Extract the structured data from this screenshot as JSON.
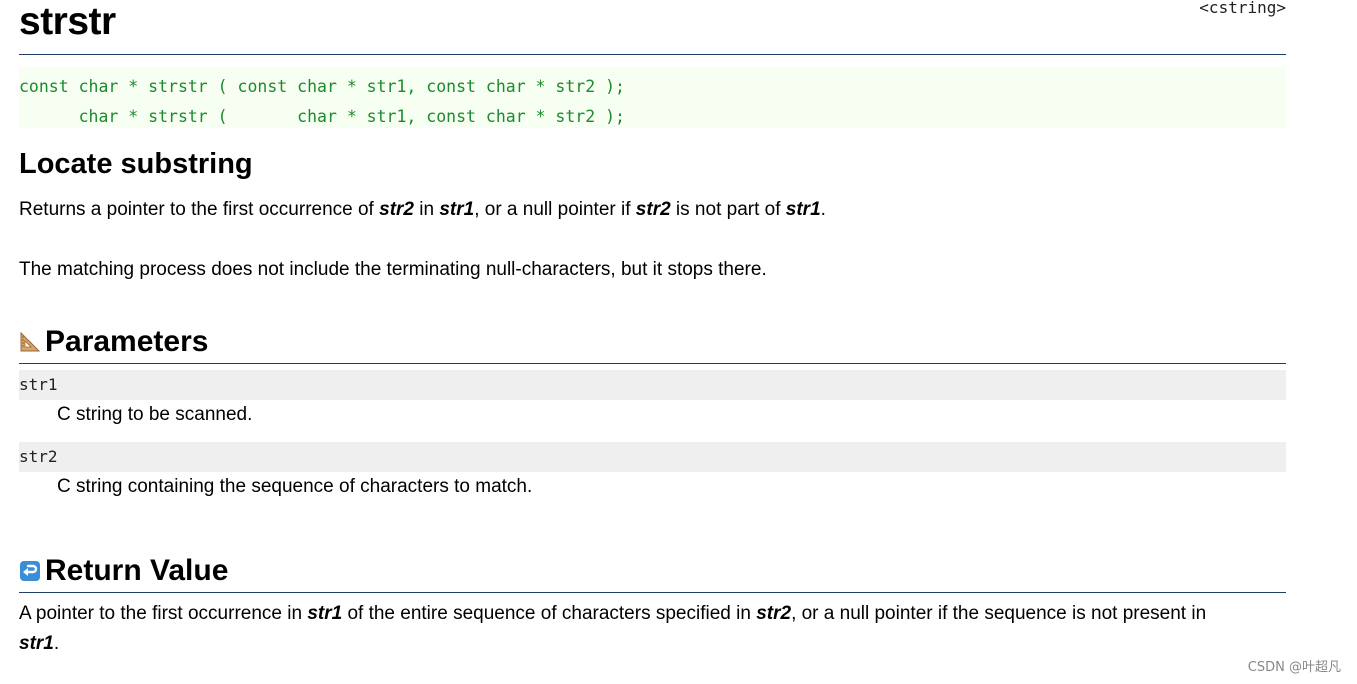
{
  "header": {
    "title": "strstr",
    "library": "<cstring>"
  },
  "prototypes": [
    "const char * strstr ( const char * str1, const char * str2 );",
    "      char * strstr (       char * str1, const char * str2 );"
  ],
  "description": {
    "heading": "Locate substring",
    "p1_parts": [
      "Returns a pointer to the first occurrence of ",
      "str2",
      " in ",
      "str1",
      ", or a null pointer if ",
      "str2",
      " is not part of ",
      "str1",
      "."
    ],
    "p2": "The matching process does not include the terminating null-characters, but it stops there."
  },
  "parameters": {
    "heading": "Parameters",
    "icon": "set-square-icon",
    "items": [
      {
        "name": "str1",
        "desc": "C string to be scanned."
      },
      {
        "name": "str2",
        "desc": "C string containing the sequence of characters to match."
      }
    ]
  },
  "return_value": {
    "heading": "Return Value",
    "icon": "return-arrow-icon",
    "parts": [
      "A pointer to the first occurrence in ",
      "str1",
      " of the entire sequence of characters specified in ",
      "str2",
      ", or a null pointer if the sequence is not present in ",
      "str1",
      "."
    ]
  },
  "watermark": "CSDN @叶超凡",
  "colors": {
    "code_green": "#1d8a2e",
    "rule_blue": "#1f3f66",
    "proto_bg": "#f6fff2",
    "param_bg": "#efefef"
  }
}
